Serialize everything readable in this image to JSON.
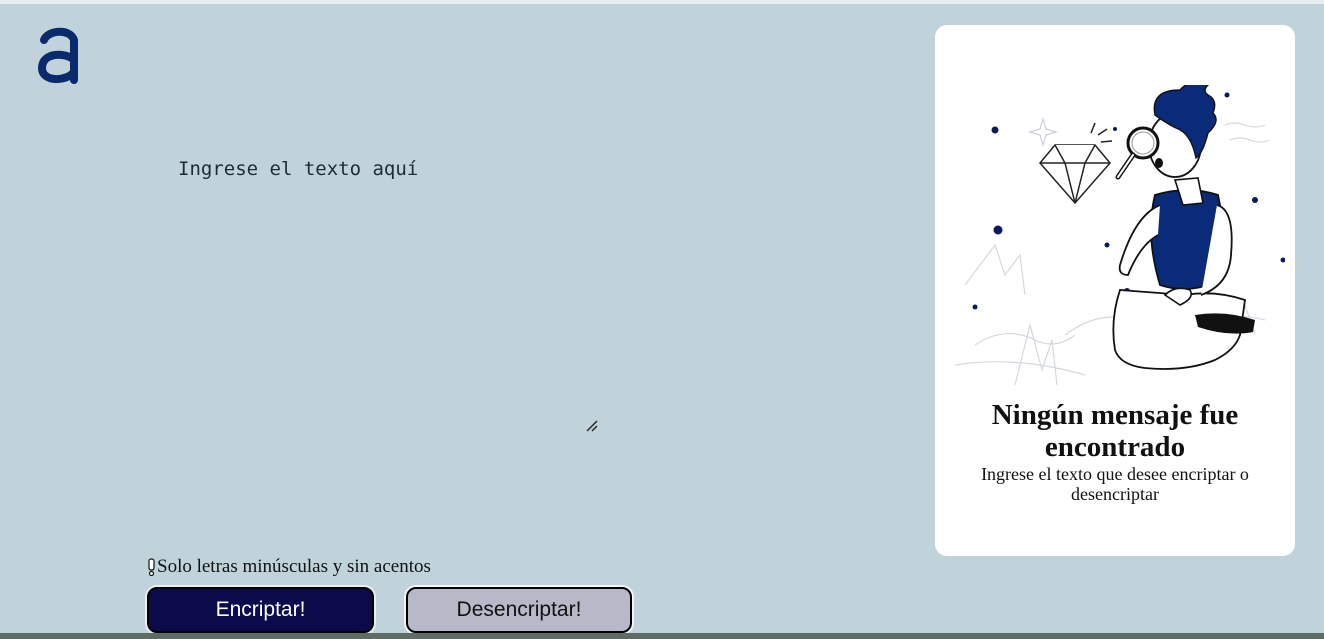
{
  "app": {
    "logo_letter": "a",
    "logo_icon": "alura-logo-icon",
    "brand_color": "#0a2a6e"
  },
  "input": {
    "placeholder": "Ingrese el texto aquí",
    "value": ""
  },
  "hint": {
    "icon": "exclamation-icon",
    "text": "Solo letras minúsculas y sin acentos"
  },
  "buttons": {
    "encrypt_label": "Encriptar!",
    "decrypt_label": "Desencriptar!"
  },
  "result_panel": {
    "illustration": "person-with-magnifier-illustration",
    "title": "Ningún mensaje fue encontrado",
    "subtitle": "Ingrese el texto que desee encriptar o desencriptar"
  },
  "colors": {
    "background": "#c0d3da",
    "encrypt_button": "#0b0a4a",
    "decrypt_button": "#b8b9c8",
    "card": "#ffffff"
  }
}
